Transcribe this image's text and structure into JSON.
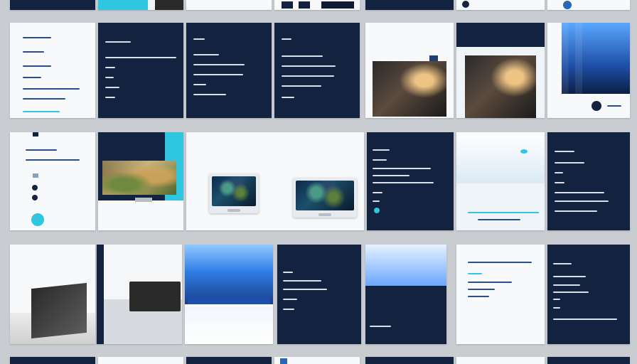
{
  "palette": {
    "background": "#c9ccd1",
    "navy": "#13233f",
    "dark_navy": "#0f1c33",
    "white": "#f7f9fb",
    "accent_cyan": "#2ec6e0",
    "accent_blue": "#2a66b8"
  },
  "gallery": {
    "rows": 5,
    "visible_text": []
  }
}
